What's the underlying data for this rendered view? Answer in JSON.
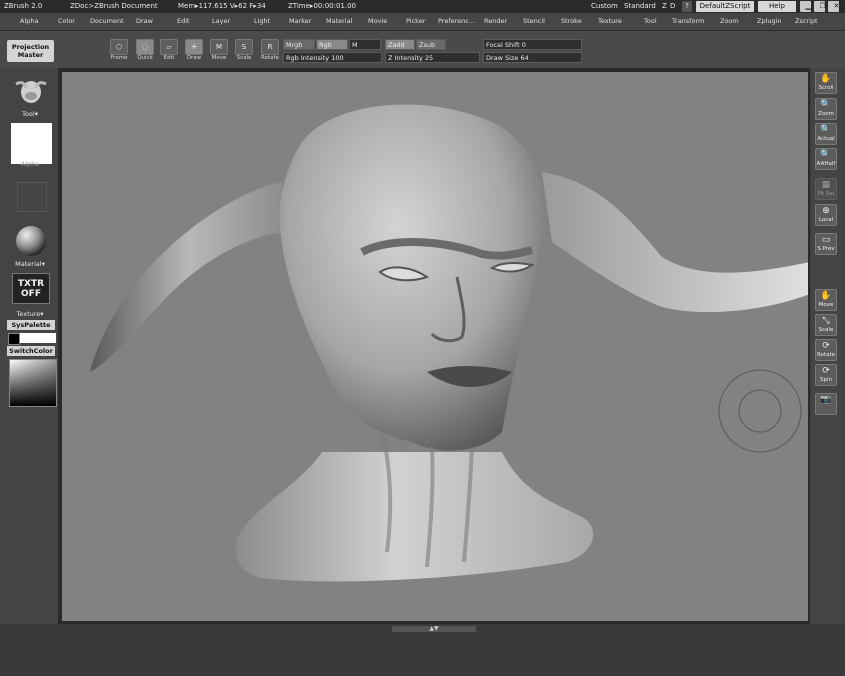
{
  "title": {
    "app": "ZBrush 2.0",
    "doc": "ZDoc>ZBrush Document",
    "mem": "Mem▸117.615 V▸62 F▸34",
    "ztime": "ZTime▸00:00:01.00",
    "custom": "Custom",
    "standard": "Standard",
    "z": "Z",
    "d": "D",
    "question": "?",
    "script_button": "DefaultZScript",
    "help_button": "Help"
  },
  "menu": [
    "Alpha",
    "Color",
    "Document",
    "Draw",
    "Edit",
    "Layer",
    "Light",
    "Marker",
    "Material",
    "Movie",
    "Picker",
    "Preferenc...",
    "Render",
    "Stencil",
    "Stroke",
    "Texture",
    "Tool",
    "Transform",
    "Zoom",
    "Zplugin",
    "Zscript"
  ],
  "shelf": {
    "projection_master": "Projection Master",
    "tools": [
      {
        "id": "frame",
        "label": "Frame",
        "glyph": "⬡"
      },
      {
        "id": "quick",
        "label": "Quick",
        "glyph": "◌"
      },
      {
        "id": "edit",
        "label": "Edit",
        "glyph": "▱"
      },
      {
        "id": "draw",
        "label": "Draw",
        "glyph": "✛"
      },
      {
        "id": "move",
        "label": "Move",
        "glyph": "M"
      },
      {
        "id": "scale",
        "label": "Scale",
        "glyph": "S"
      },
      {
        "id": "rotate",
        "label": "Rotate",
        "glyph": "R"
      }
    ],
    "mrgb": "Mrgb",
    "rgb": "Rgb",
    "m": "M",
    "zadd": "Zadd",
    "zsub": "Zsub",
    "rgb_intensity_label": "Rgb Intensity",
    "rgb_intensity_value": "100",
    "z_intensity_label": "Z Intensity",
    "z_intensity_value": "25",
    "focal_shift_label": "Focal Shift",
    "focal_shift_value": "0",
    "draw_size_label": "Draw Size",
    "draw_size_value": "64"
  },
  "left": {
    "tool_label": "Tool",
    "alpha_label": "Alpha",
    "material_label": "Material",
    "txtr_off": "TXTR OFF",
    "texture_label": "Texture",
    "syspalette": "SysPalette",
    "switchcolor": "SwitchColor"
  },
  "right": [
    {
      "id": "scroll",
      "label": "Scroll",
      "glyph": "✋"
    },
    {
      "id": "zoom",
      "label": "Zoom",
      "glyph": "🔍"
    },
    {
      "id": "actual",
      "label": "Actual",
      "glyph": "🔍"
    },
    {
      "id": "aahalf",
      "label": "AAHalf",
      "glyph": "🔍"
    },
    {
      "id": "fit-sel",
      "label": "Fit Sel",
      "glyph": "▦"
    },
    {
      "id": "local",
      "label": "Local",
      "glyph": "⊕"
    },
    {
      "id": "sprev",
      "label": "S.Prev",
      "glyph": "▭"
    },
    {
      "id": "move",
      "label": "Move",
      "glyph": "✋"
    },
    {
      "id": "scale",
      "label": "Scale",
      "glyph": "⤡"
    },
    {
      "id": "rotate",
      "label": "Rotate",
      "glyph": "⟳"
    },
    {
      "id": "spin",
      "label": "Spin",
      "glyph": "⟳"
    },
    {
      "id": "snapshot",
      "label": "",
      "glyph": "📷"
    }
  ],
  "colors": {
    "canvas": "#828282",
    "panel": "#444444",
    "titlebar": "#2b2b2b"
  }
}
